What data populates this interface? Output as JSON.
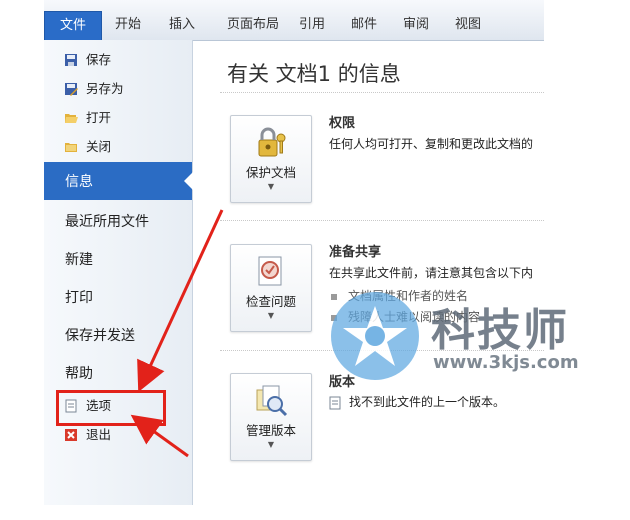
{
  "ribbon": {
    "tabs": [
      "文件",
      "开始",
      "插入",
      "页面布局",
      "引用",
      "邮件",
      "审阅",
      "视图"
    ]
  },
  "backstage": {
    "commands": {
      "save": "保存",
      "save_as": "另存为",
      "open": "打开",
      "close": "关闭"
    },
    "nav": {
      "info": "信息",
      "recent": "最近所用文件",
      "new": "新建",
      "print": "打印",
      "save_send": "保存并发送",
      "help": "帮助"
    },
    "bottom": {
      "options": "选项",
      "exit": "退出"
    }
  },
  "info": {
    "title": "有关 文档1 的信息",
    "permissions": {
      "button": "保护文档",
      "heading": "权限",
      "desc": "任何人均可打开、复制和更改此文档的"
    },
    "prepare": {
      "button": "检查问题",
      "heading": "准备共享",
      "desc": "在共享此文件前，请注意其包含以下内",
      "bullets": [
        "文档属性和作者的姓名",
        "残障人士难以阅读的内容"
      ]
    },
    "versions": {
      "button": "管理版本",
      "heading": "版本",
      "desc": "找不到此文件的上一个版本。"
    }
  },
  "watermark": {
    "brand": "科技师",
    "url": "www.3kjs.com"
  },
  "colors": {
    "accent": "#2b6cc4",
    "highlight_box": "#e2221a"
  }
}
